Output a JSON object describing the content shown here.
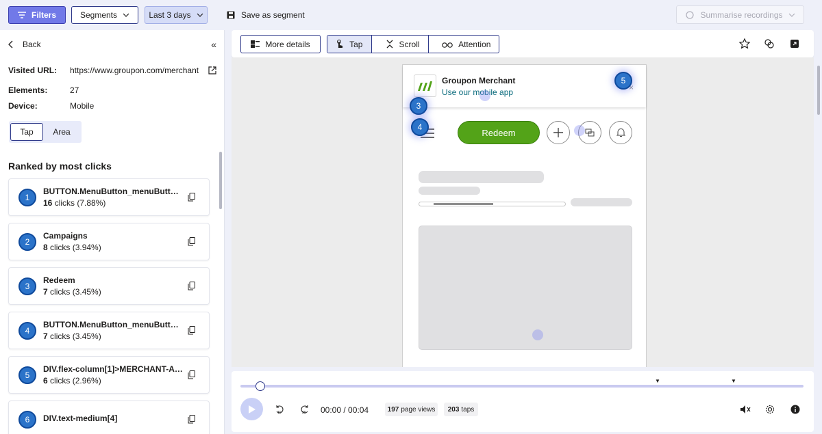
{
  "topbar": {
    "filters_label": "Filters",
    "segments_label": "Segments",
    "date_range_label": "Last 3 days",
    "save_segment_label": "Save as segment",
    "summarise_label": "Summarise recordings"
  },
  "left_panel": {
    "back_label": "Back",
    "details": [
      {
        "key": "Visited URL:",
        "value": "https://www.groupon.com/merchant"
      },
      {
        "key": "Elements:",
        "value": "27"
      },
      {
        "key": "Device:",
        "value": "Mobile"
      }
    ],
    "toggle": {
      "tap": "Tap",
      "area": "Area"
    },
    "ranked_title": "Ranked by most clicks",
    "items": [
      {
        "rank": "1",
        "name": "BUTTON.MenuButton_menuButton_...",
        "clicks": "16",
        "suffix": "clicks (7.88%)"
      },
      {
        "rank": "2",
        "name": "Campaigns",
        "clicks": "8",
        "suffix": "clicks (3.94%)"
      },
      {
        "rank": "3",
        "name": "Redeem",
        "clicks": "7",
        "suffix": "clicks (3.45%)"
      },
      {
        "rank": "4",
        "name": "BUTTON.MenuButton_menuButton_...",
        "clicks": "7",
        "suffix": "clicks (3.45%)"
      },
      {
        "rank": "5",
        "name": "DIV.flex-column[1]>MERCHANT-APP...",
        "clicks": "6",
        "suffix": "clicks (2.96%)"
      },
      {
        "rank": "6",
        "name": "DIV.text-medium[4]",
        "clicks": "",
        "suffix": ""
      }
    ]
  },
  "toolbar": {
    "more_details_label": "More details",
    "tap_label": "Tap",
    "scroll_label": "Scroll",
    "attention_label": "Attention"
  },
  "phone": {
    "app_title": "Groupon Merchant",
    "app_link": "Use our mobile app",
    "redeem_label": "Redeem",
    "heat_markers": [
      "3",
      "4",
      "5"
    ],
    "accent_green": "#53a318"
  },
  "player": {
    "time": "00:00 / 00:04",
    "page_views_count": "197",
    "page_views_label": "page views",
    "taps_count": "203",
    "taps_label": "taps",
    "progress": 0.0
  },
  "colors": {
    "accent": "#2f3a8a",
    "marker_blue": "#2b73c9",
    "filters_bg": "#7179e8"
  }
}
